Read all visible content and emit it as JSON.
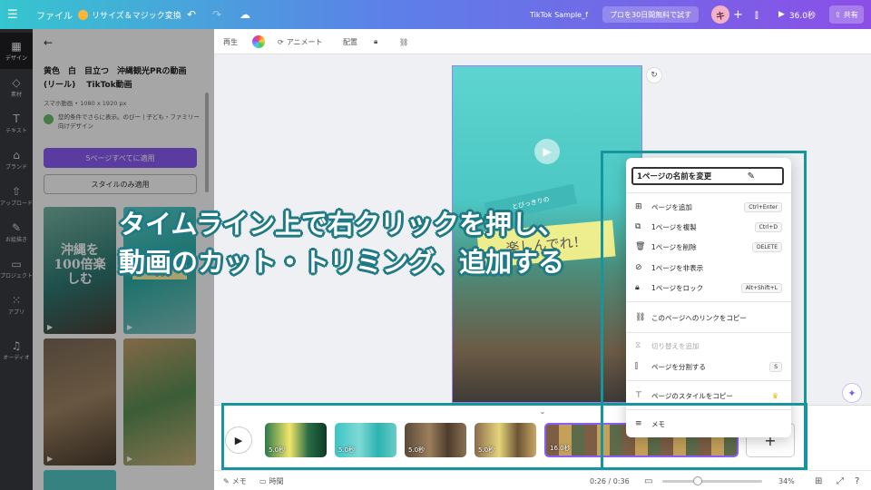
{
  "topbar": {
    "menu_icon": "hamburger-icon",
    "file": "ファイル",
    "resize": "リサイズ＆マジック変換",
    "title": "TikTok Sample_f",
    "trial": "プロを30日間無料で試す",
    "avatar": "キ",
    "play_time": "36.0秒",
    "share": "共有"
  },
  "rail": {
    "items": [
      {
        "label": "デザイン",
        "icon": "layout-icon"
      },
      {
        "label": "素材",
        "icon": "shapes-icon"
      },
      {
        "label": "テキスト",
        "icon": "text-icon"
      },
      {
        "label": "ブランド",
        "icon": "brand-icon"
      },
      {
        "label": "アップロード",
        "icon": "upload-icon"
      },
      {
        "label": "お絵描き",
        "icon": "draw-icon"
      },
      {
        "label": "プロジェクト",
        "icon": "folder-icon"
      },
      {
        "label": "アプリ",
        "icon": "apps-icon"
      },
      {
        "label": "オーディオ",
        "icon": "audio-icon"
      }
    ]
  },
  "panel": {
    "title": "黄色　白　目立つ　沖縄観光PRの動画(リール)　 TikTok動画",
    "subtitle": "スマホ動画 • 1080 x 1920 px",
    "tag": "您的条件でさらに表示。のびー | 子ども・ファミリー向けデザイン",
    "apply_all": "5ページすべてに適用",
    "style_only": "スタイルのみ適用",
    "thumb1_text": "沖縄を100倍楽しむ",
    "thumb2_text": "アクティビティを楽しむ"
  },
  "toolbar": {
    "play": "再生",
    "animate": "アニメート",
    "position": "配置"
  },
  "page": {
    "ribbon": "とびっきりの",
    "big": "楽しんでれ！"
  },
  "caption": {
    "line1": "タイムライン上で右クリックを押し、",
    "line2": "動画のカット・トリミング、追加する"
  },
  "context_menu": {
    "rename": "1ページの名前を変更",
    "items": [
      {
        "label": "ページを追加",
        "shortcut": "Ctrl+Enter",
        "icon": "add-page-icon",
        "disabled": false
      },
      {
        "label": "1ページを複製",
        "shortcut": "Ctrl+D",
        "icon": "duplicate-icon",
        "disabled": false
      },
      {
        "label": "1ページを削除",
        "shortcut": "DELETE",
        "icon": "trash-icon",
        "disabled": false
      },
      {
        "label": "1ページを非表示",
        "shortcut": "",
        "icon": "eye-off-icon",
        "disabled": false
      },
      {
        "label": "1ページをロック",
        "shortcut": "Alt+Shift+L",
        "icon": "lock-icon",
        "disabled": false
      },
      {
        "label": "このページへのリンクをコピー",
        "shortcut": "",
        "icon": "link-icon",
        "disabled": false
      },
      {
        "label": "切り替えを追加",
        "shortcut": "",
        "icon": "transition-icon",
        "disabled": true
      },
      {
        "label": "ページを分割する",
        "shortcut": "S",
        "icon": "split-icon",
        "disabled": false
      },
      {
        "label": "ページのスタイルをコピー",
        "shortcut": "",
        "icon": "paint-roller-icon",
        "disabled": false
      },
      {
        "label": "メモ",
        "shortcut": "",
        "icon": "notes-icon",
        "disabled": false
      }
    ]
  },
  "timeline": {
    "clips": [
      {
        "duration": "5.0秒"
      },
      {
        "duration": "5.0秒"
      },
      {
        "duration": "5.0秒"
      },
      {
        "duration": "5.0秒"
      },
      {
        "duration": "16.0秒"
      }
    ],
    "add": "+"
  },
  "statusbar": {
    "memo": "メモ",
    "time": "時間",
    "position": "0:26 / 0:36",
    "zoom": "34%"
  },
  "colors": {
    "accent": "#8b5cf6",
    "highlight": "#16959f",
    "caption_outline": "#1f7a86"
  }
}
